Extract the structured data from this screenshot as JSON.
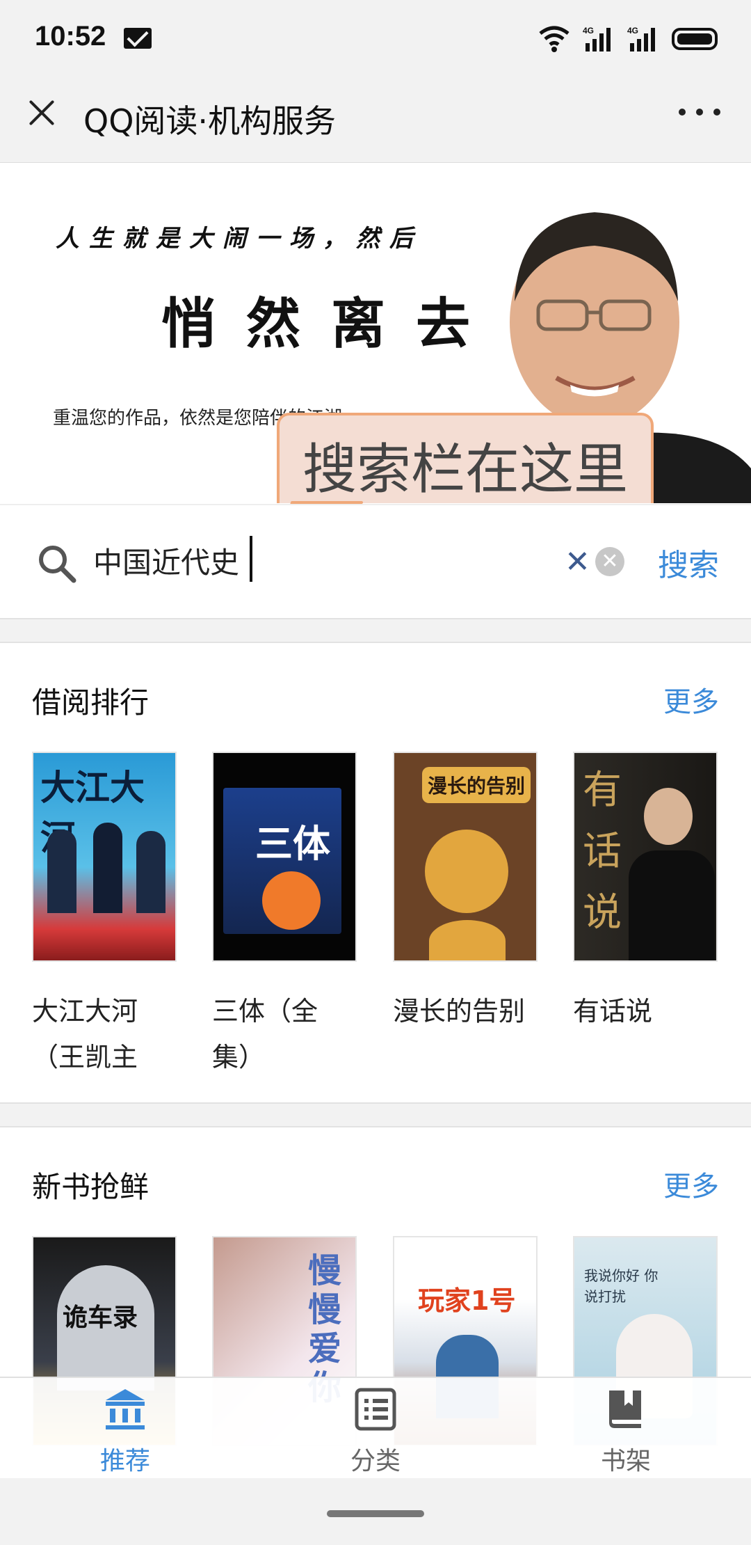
{
  "status_bar": {
    "time": "10:52",
    "network_1": "4G",
    "network_2": "4G"
  },
  "title_bar": {
    "title": "QQ阅读·机构服务"
  },
  "banner": {
    "line1": "人生就是大闹一场，然后",
    "line2": "悄然离去",
    "line3": "重温您的作品，依然是您陪伴的江湖",
    "callout": "搜索栏在这里"
  },
  "search": {
    "value": "中国近代史",
    "button_label": "搜索"
  },
  "sections": [
    {
      "title": "借阅排行",
      "more_label": "更多",
      "books": [
        {
          "title": "大江大河（王凯主",
          "cover_text": "大江大河"
        },
        {
          "title": "三体（全集）",
          "cover_text": "三体"
        },
        {
          "title": "漫长的告别",
          "cover_text": "漫长的告别"
        },
        {
          "title": "有话说",
          "cover_text": "有话说"
        }
      ]
    },
    {
      "title": "新书抢鲜",
      "more_label": "更多",
      "books": [
        {
          "title": "",
          "cover_text": "诡车录"
        },
        {
          "title": "",
          "cover_text": "慢慢爱你"
        },
        {
          "title": "",
          "cover_text": "玩家1号"
        },
        {
          "title": "",
          "cover_text": "我说你好 你说打扰"
        }
      ]
    }
  ],
  "bottom_nav": {
    "items": [
      {
        "label": "推荐",
        "icon": "bank-icon",
        "active": true
      },
      {
        "label": "分类",
        "icon": "list-icon",
        "active": false
      },
      {
        "label": "书架",
        "icon": "bookmark-book-icon",
        "active": false
      }
    ],
    "active_color": "#3b8ad9",
    "inactive_color": "#666666"
  },
  "colors": {
    "accent": "#3b8ad9",
    "callout_border": "#f0a879"
  }
}
